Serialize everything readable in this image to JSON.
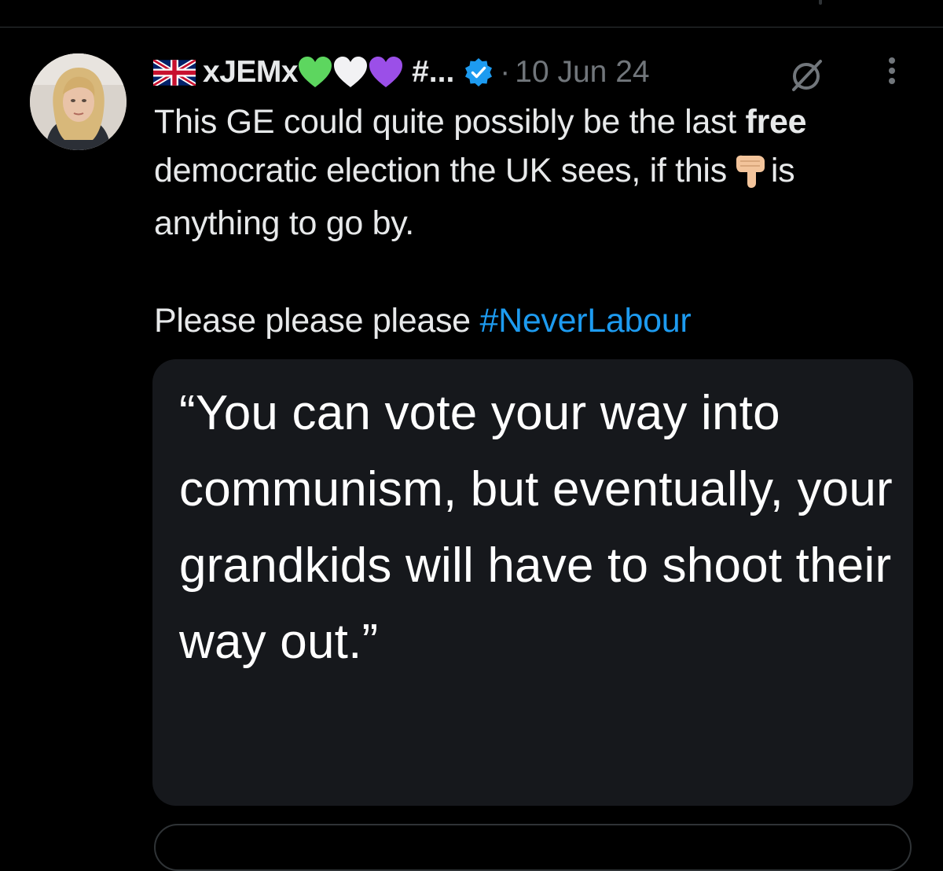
{
  "post": {
    "author": {
      "display_name": "xJEMx",
      "flag_icon": "uk-flag-icon",
      "heart_icons": [
        {
          "name": "green-heart-icon",
          "color": "#5dd65f"
        },
        {
          "name": "white-heart-icon",
          "color": "#f2f2f4"
        },
        {
          "name": "purple-heart-icon",
          "color": "#9b4fe8"
        }
      ],
      "handle_truncated": "#...",
      "verified_icon": "verified-badge-icon",
      "verified_color": "#1d9bf0"
    },
    "separator": "·",
    "timestamp": "10 Jun 24",
    "text": {
      "line1_pre": "This GE could quite possibly be the last ",
      "line1_bold": "free",
      "line2_pre": "democratic election the UK sees, if this",
      "pointing_icon": "backhand-index-pointing-down-icon",
      "line2_post": "is",
      "line3": "anything to go by.",
      "line4_pre": "Please please please ",
      "hashtag": "#NeverLabour"
    },
    "media": {
      "quote": "“You can vote your way into communism, but eventually, your grandkids will have to shoot their way out.”"
    }
  },
  "colors": {
    "background": "#000000",
    "text": "#e7e9ea",
    "muted": "#71767b",
    "link": "#1d9bf0",
    "card": "#16181c"
  }
}
